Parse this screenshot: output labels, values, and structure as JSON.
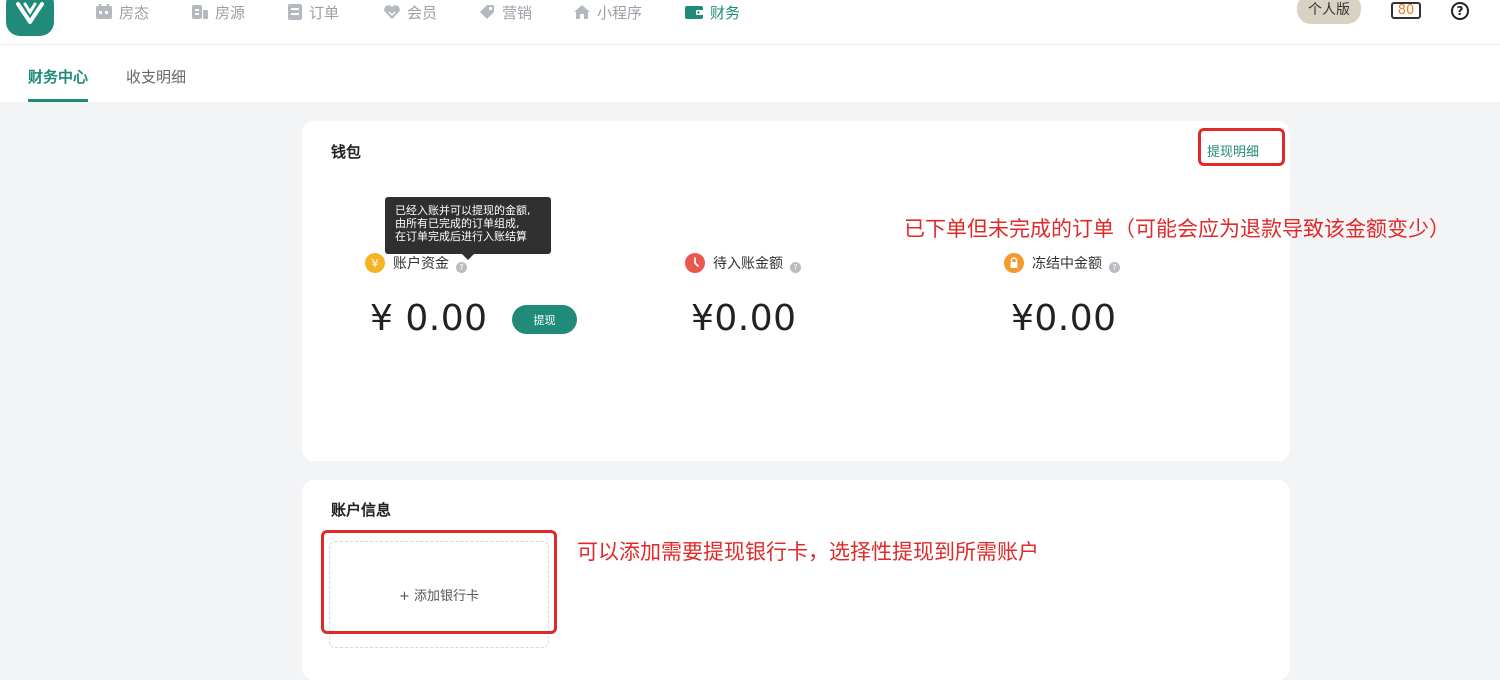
{
  "nav": {
    "items": [
      {
        "label": "房态",
        "icon": "calendar-icon"
      },
      {
        "label": "房源",
        "icon": "house-source-icon"
      },
      {
        "label": "订单",
        "icon": "order-icon"
      },
      {
        "label": "会员",
        "icon": "member-heart-icon"
      },
      {
        "label": "营销",
        "icon": "tag-icon"
      },
      {
        "label": "小程序",
        "icon": "home-icon"
      },
      {
        "label": "财务",
        "icon": "wallet-icon",
        "active": true
      }
    ],
    "plan_badge": "个人版",
    "count_badge": "80",
    "help": "?"
  },
  "tabs": [
    {
      "label": "财务中心",
      "active": true
    },
    {
      "label": "收支明细",
      "active": false
    }
  ],
  "wallet": {
    "title": "钱包",
    "withdraw_detail_link": "提现明细",
    "tooltip_lines": [
      "已经入账并可以提现的金额,",
      "由所有已完成的订单组成,",
      "在订单完成后进行入账结算"
    ],
    "stats": [
      {
        "label": "账户资金",
        "amount": "¥ 0.00",
        "icon": "yen-coin-icon"
      },
      {
        "label": "待入账金额",
        "amount": "¥0.00",
        "icon": "clock-icon"
      },
      {
        "label": "冻结中金额",
        "amount": "¥0.00",
        "icon": "lock-icon"
      }
    ],
    "withdraw_button": "提现"
  },
  "account": {
    "title": "账户信息",
    "add_card": "+ 添加银行卡"
  },
  "annotations": {
    "pending_note": "已下单但未完成的订单（可能会应为退款导致该金额变少）",
    "card_note": "可以添加需要提现银行卡，选择性提现到所需账户"
  },
  "colors": {
    "brand": "#1f8b78",
    "annotation_red": "#e02a2a",
    "coin_yellow": "#f5b523",
    "clock_red": "#e9574e",
    "lock_orange": "#f39a2d"
  }
}
